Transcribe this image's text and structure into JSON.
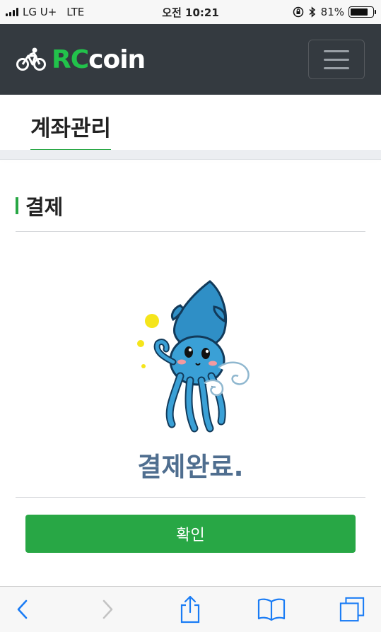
{
  "status": {
    "carrier": "LG U+",
    "network": "LTE",
    "time": "오전 10:21",
    "battery": "81%",
    "battery_level": 0.81
  },
  "header": {
    "brand_rc": "RC",
    "brand_coin": "coin",
    "brand_icon": "bicycle-icon",
    "menu_icon": "hamburger-menu-icon"
  },
  "tabs": [
    {
      "label": "계좌관리",
      "active": true
    }
  ],
  "section": {
    "title": "결제"
  },
  "result": {
    "message": "결제완료."
  },
  "confirm_button": {
    "label": "확인"
  },
  "browser_toolbar": {
    "icons": [
      "back-icon",
      "forward-icon",
      "share-icon",
      "bookmarks-icon",
      "tabs-icon"
    ]
  },
  "colors": {
    "header_bg": "#343a40",
    "accent_green": "#28a745",
    "brand_green": "#22c24b",
    "message_color": "#4f6e8f",
    "ios_blue": "#1a7cf5"
  }
}
